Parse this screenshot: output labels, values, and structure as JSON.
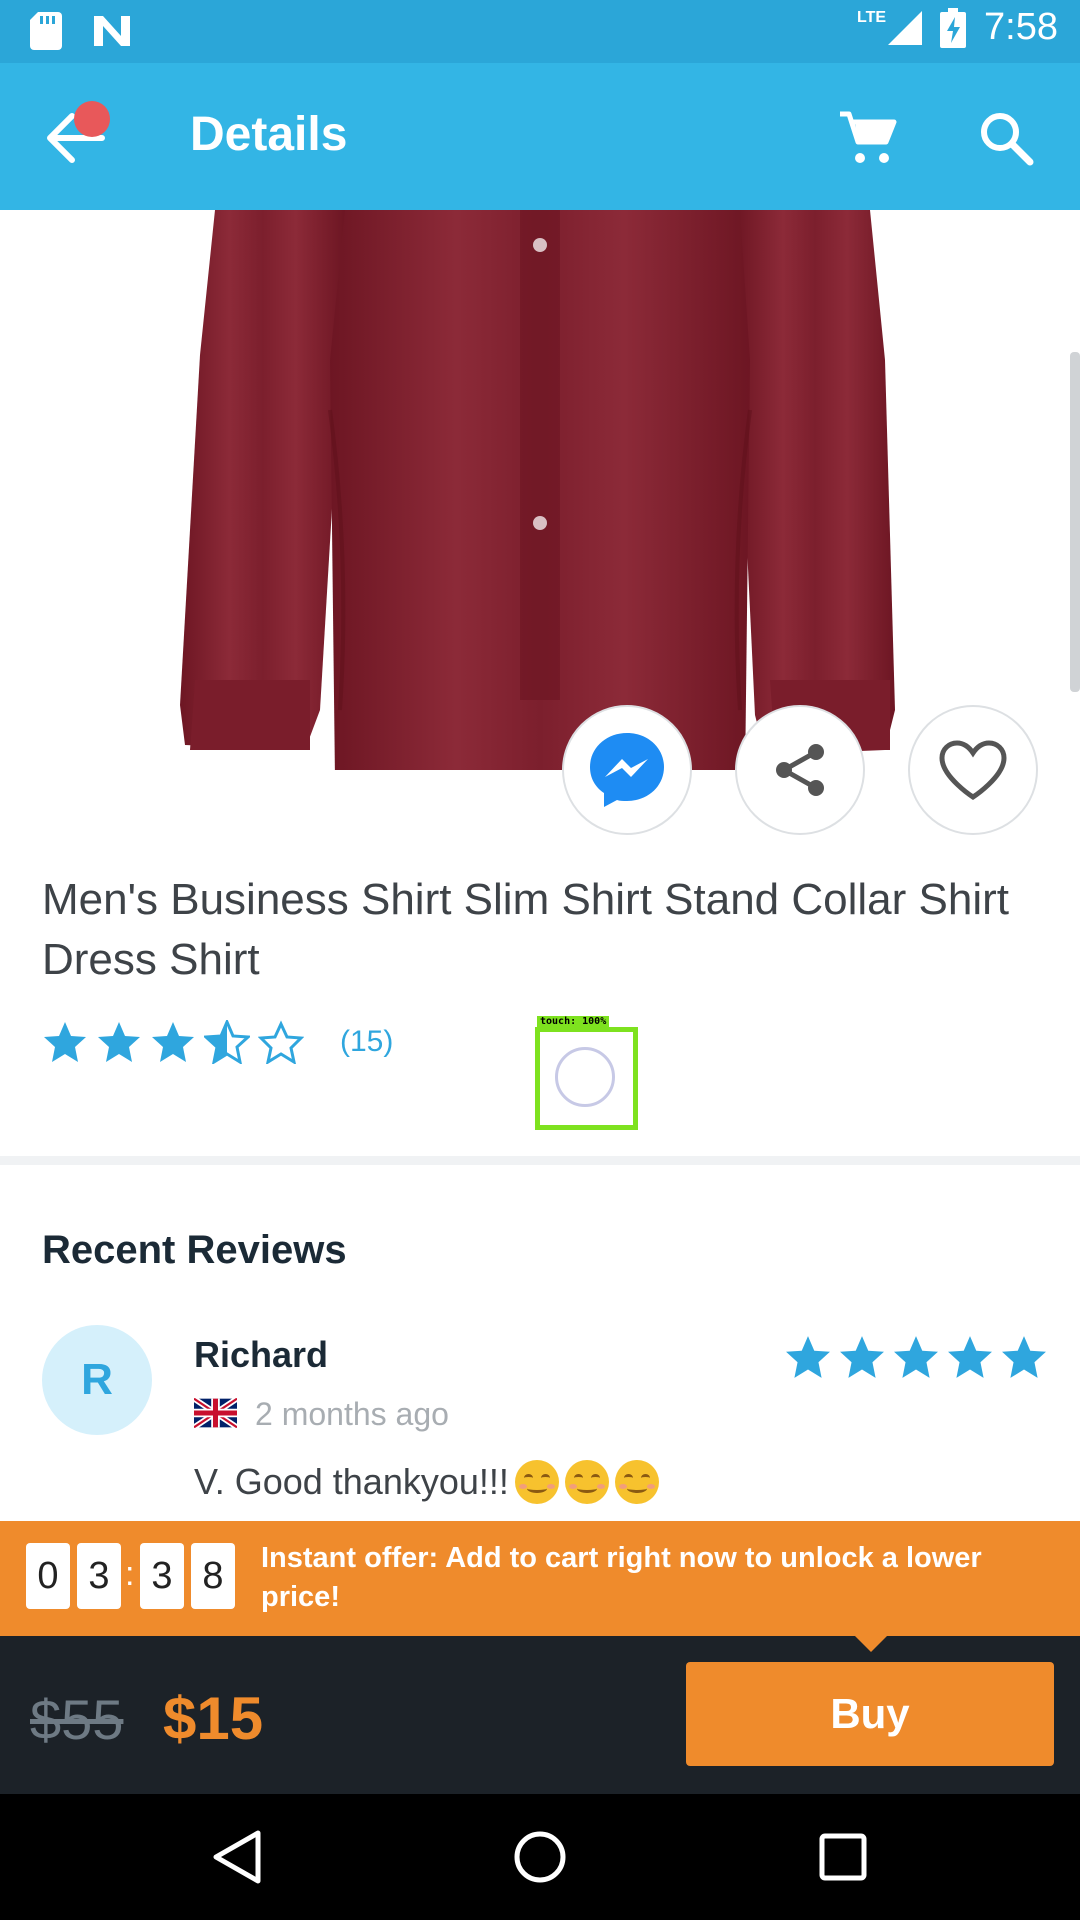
{
  "status_bar": {
    "time": "7:58",
    "network": "LTE",
    "icons": [
      "sd-card-icon",
      "n-notification-icon",
      "signal-icon",
      "battery-charging-icon"
    ]
  },
  "app_bar": {
    "title": "Details",
    "icons": [
      "back-arrow-icon",
      "cart-icon",
      "search-icon"
    ],
    "color": "#33b5e5"
  },
  "product": {
    "title": "Men's Business Shirt Slim Shirt Stand Collar Shirt Dress Shirt",
    "rating": 3.5,
    "rating_max": 5,
    "review_count": "(15)",
    "actions": [
      "messenger-icon",
      "share-icon",
      "heart-icon"
    ]
  },
  "touch_indicator": {
    "label": "touch: 100%"
  },
  "reviews": {
    "heading": "Recent Reviews",
    "items": [
      {
        "avatar_initial": "R",
        "name": "Richard",
        "date": "2 months ago",
        "stars": 5,
        "text": "V. Good thankyou!!!"
      }
    ]
  },
  "offer": {
    "timer_digits": [
      "0",
      "3",
      "3",
      "8"
    ],
    "separator": ":",
    "text": "Instant offer: Add to cart right now to unlock a lower price!",
    "color": "#ef8b2c"
  },
  "purchase": {
    "old_price": "$55",
    "new_price": "$15",
    "buy_label": "Buy"
  },
  "nav_bar": {
    "icons": [
      "back-triangle-icon",
      "home-circle-icon",
      "recents-square-icon"
    ]
  }
}
